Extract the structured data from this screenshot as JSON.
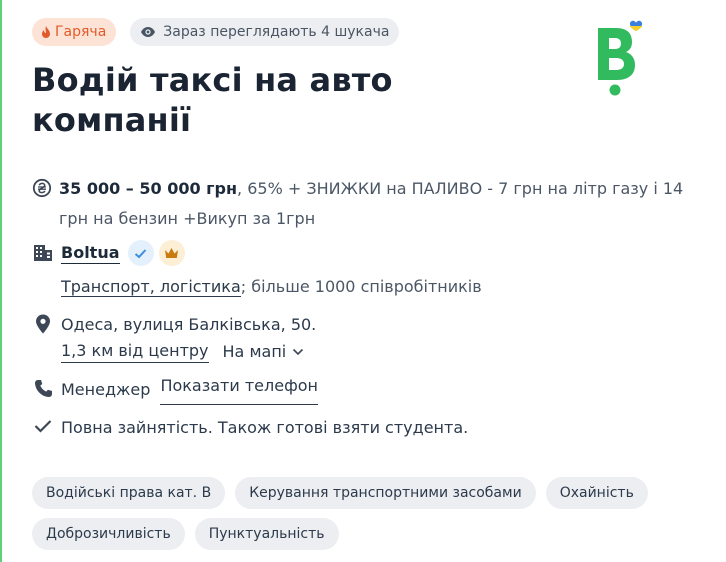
{
  "badges": {
    "hot_label": "Гаряча",
    "viewing_label": "Зараз переглядають 4 шукача"
  },
  "logo": {
    "brand": "Bolt",
    "icon": "bolt-logo-ukraine-heart"
  },
  "vacancy": {
    "title": "Водій таксі на авто компанії"
  },
  "salary": {
    "range": "35 000 – 50 000 грн",
    "description": ", 65% + ЗНИЖКИ на ПАЛИВО - 7 грн на літр газу і 14 грн на бензин +Викуп за 1грн"
  },
  "company": {
    "name": "Boltua",
    "category": "Транспорт, логістика",
    "size": "; більше 1000 співробітників"
  },
  "location": {
    "address": "Одеса, вулиця Балківська, 50.",
    "distance": "1,3 км від центру",
    "map_label": "На мапі"
  },
  "contact": {
    "role": "Менеджер",
    "show_phone": "Показати телефон"
  },
  "employment": "Повна зайнятість. Також готові взяти студента.",
  "tags": [
    "Водійські права кат. B",
    "Керування транспортними засобами",
    "Охайність",
    "Доброзичливість",
    "Пунктуальність"
  ],
  "colors": {
    "accent_green": "#32bb5e",
    "hot_bg": "#fde3d6",
    "hot_text": "#e25a2b",
    "tag_bg": "#eceef2"
  }
}
